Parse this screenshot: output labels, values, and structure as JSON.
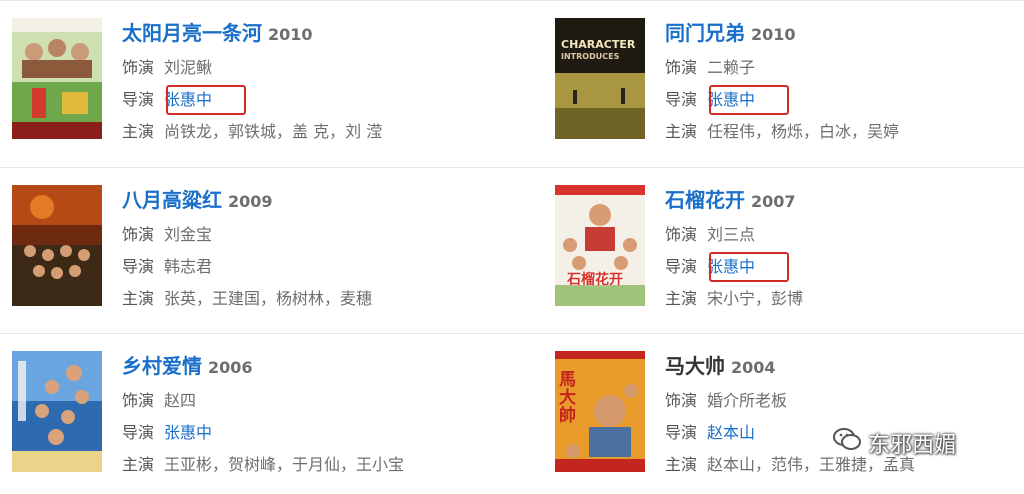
{
  "labels": {
    "cast": "饰演",
    "director": "导演",
    "stars": "主演"
  },
  "films": [
    {
      "title": "太阳月亮一条河",
      "year": "2010",
      "cast": "刘泥鳅",
      "director": "张惠中",
      "stars": "尚铁龙，郭铁城，盖 克，刘 滢",
      "director_highlighted": true
    },
    {
      "title": "同门兄弟",
      "year": "2010",
      "cast": "二赖子",
      "director": "张惠中",
      "stars": "任程伟，杨烁，白冰，吴婷",
      "director_highlighted": true,
      "poster_text": [
        "CHARACTER",
        "INTRODUCES"
      ]
    },
    {
      "title": "八月高粱红",
      "year": "2009",
      "cast": "刘金宝",
      "director": "韩志君",
      "stars": "张英，王建国，杨树林，麦穗",
      "director_highlighted": false
    },
    {
      "title": "石榴花开",
      "year": "2007",
      "cast": "刘三点",
      "director": "张惠中",
      "stars": "宋小宁，彭博",
      "director_highlighted": true,
      "poster_text": [
        "石榴花开"
      ]
    },
    {
      "title": "乡村爱情",
      "year": "2006",
      "cast": "赵四",
      "director": "张惠中",
      "stars": "王亚彬，贺树峰，于月仙，王小宝",
      "director_highlighted": false
    },
    {
      "title": "马大帅",
      "year": "2004",
      "cast": "婚介所老板",
      "director": "赵本山",
      "stars": "赵本山，范伟，王雅捷，孟真",
      "director_highlighted": false,
      "poster_text": [
        "馬大帥"
      ]
    }
  ],
  "watermark": {
    "text": "东邪西媚",
    "icon": "wechat-icon"
  },
  "colors": {
    "link": "#1a6fc9",
    "highlight_box": "#d22c25",
    "year": "#6e6e6e"
  }
}
